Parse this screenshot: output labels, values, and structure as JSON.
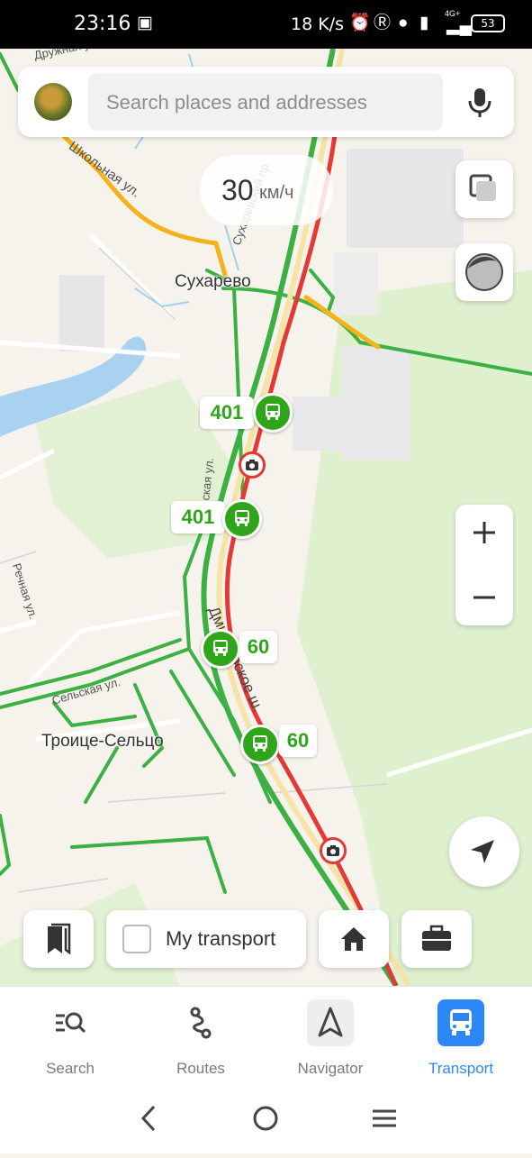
{
  "status_bar": {
    "time": "23:16",
    "network_speed": "18 K/s",
    "battery_level": "53",
    "network_type": "4G+"
  },
  "search": {
    "placeholder": "Search places and addresses"
  },
  "speed_limit": {
    "value": "30",
    "unit": "км/ч"
  },
  "map": {
    "places": {
      "sukharevo": "Сухарево",
      "troitse_seltso": "Троице-Сельцо"
    },
    "streets": {
      "shkolnaya": "Школьная ул.",
      "druzhnaya": "Дружная ул.",
      "sharapovo": "Сухаревский пр.",
      "zavodskaya": "Заводская ул.",
      "rechnaya": "Речная ул.",
      "selskaya": "Сельская ул.",
      "dmitrovskoe": "Дмитровское ш."
    },
    "stops": [
      {
        "route": "401"
      },
      {
        "route": "401"
      },
      {
        "route": "60"
      },
      {
        "route": "60"
      }
    ]
  },
  "bottom_bar": {
    "my_transport_label": "My transport"
  },
  "tabs": [
    {
      "label": "Search",
      "icon": "search-list-icon"
    },
    {
      "label": "Routes",
      "icon": "route-icon"
    },
    {
      "label": "Navigator",
      "icon": "navigator-arrow-icon"
    },
    {
      "label": "Transport",
      "icon": "bus-icon",
      "active": true
    }
  ],
  "colors": {
    "accent_blue": "#2d87f5",
    "transport_green": "#2fa51a",
    "traffic_red": "#e53935",
    "traffic_yellow": "#f5b21b",
    "road_green": "#3cb043"
  }
}
